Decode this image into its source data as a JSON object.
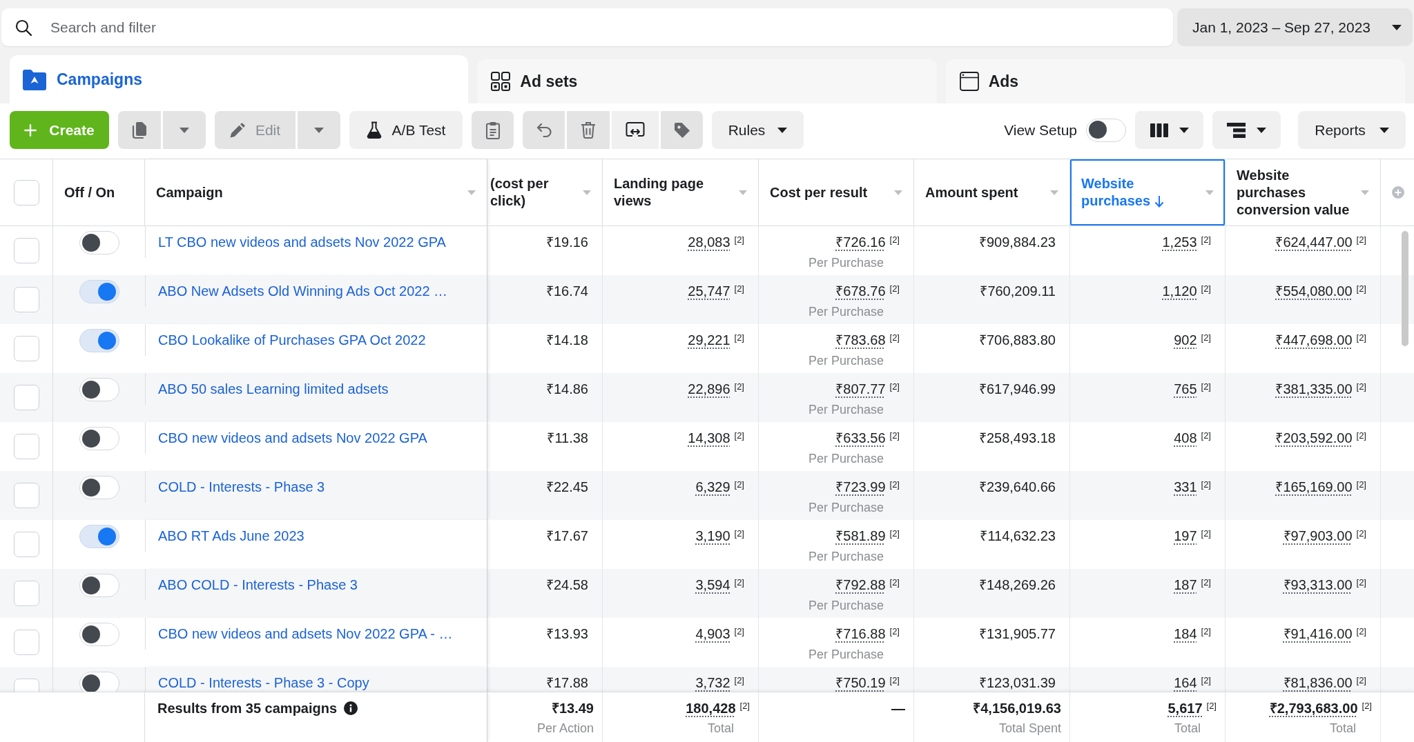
{
  "search": {
    "placeholder": "Search and filter"
  },
  "date_range": {
    "label": "Jan 1, 2023 – Sep 27, 2023"
  },
  "tabs": [
    {
      "label": "Campaigns",
      "selected": true
    },
    {
      "label": "Ad sets",
      "selected": false
    },
    {
      "label": "Ads",
      "selected": false
    }
  ],
  "toolbar": {
    "create": {
      "label": "Create"
    },
    "duplicate": {
      "disabled": true
    },
    "edit": {
      "label": "Edit",
      "disabled": true
    },
    "ab_test": {
      "label": "A/B Test",
      "disabled": false
    },
    "icon_buttons": [
      {
        "disabled": true
      },
      {
        "disabled": true
      },
      {
        "disabled": true
      },
      {
        "disabled": false
      },
      {
        "disabled": true
      }
    ],
    "rules": {
      "label": "Rules"
    },
    "view_setup": {
      "label": "View Setup",
      "on": false
    },
    "reports": {
      "label": "Reports"
    }
  },
  "table": {
    "select_all": {
      "checked": false
    },
    "toggle_header": {
      "label": "Off / On"
    },
    "name_header": {
      "label": "Campaign",
      "sorted": false
    },
    "columns": [
      {
        "label": "(cost per click)",
        "sorted": false
      },
      {
        "label": "Landing page views",
        "sorted": false
      },
      {
        "label": "Cost per result",
        "sorted": false
      },
      {
        "label": "Amount spent",
        "sorted": false
      },
      {
        "label": "Website purchases",
        "sorted": true
      },
      {
        "label": "Website purchases conversion value",
        "sorted": false
      }
    ],
    "rows": [
      {
        "selected": false,
        "on": false,
        "campaign": "LT CBO new videos and adsets Nov 2022 GPA",
        "cells": [
          {
            "value": "₹19.16"
          },
          {
            "value": "28,083",
            "note": "[2]"
          },
          {
            "value": "₹726.16",
            "note": "[2]",
            "caption": "Per Purchase"
          },
          {
            "value": "₹909,884.23"
          },
          {
            "value": "1,253",
            "note": "[2]"
          },
          {
            "value": "₹624,447.00",
            "note": "[2]"
          }
        ]
      },
      {
        "selected": false,
        "on": true,
        "campaign": "ABO New Adsets Old Winning Ads Oct 2022 …",
        "cells": [
          {
            "value": "₹16.74"
          },
          {
            "value": "25,747",
            "note": "[2]"
          },
          {
            "value": "₹678.76",
            "note": "[2]",
            "caption": "Per Purchase"
          },
          {
            "value": "₹760,209.11"
          },
          {
            "value": "1,120",
            "note": "[2]"
          },
          {
            "value": "₹554,080.00",
            "note": "[2]"
          }
        ]
      },
      {
        "selected": false,
        "on": true,
        "campaign": "CBO Lookalike of Purchases GPA Oct 2022",
        "cells": [
          {
            "value": "₹14.18"
          },
          {
            "value": "29,221",
            "note": "[2]"
          },
          {
            "value": "₹783.68",
            "note": "[2]",
            "caption": "Per Purchase"
          },
          {
            "value": "₹706,883.80"
          },
          {
            "value": "902",
            "note": "[2]"
          },
          {
            "value": "₹447,698.00",
            "note": "[2]"
          }
        ]
      },
      {
        "selected": false,
        "on": false,
        "campaign": "ABO 50 sales Learning limited adsets",
        "cells": [
          {
            "value": "₹14.86"
          },
          {
            "value": "22,896",
            "note": "[2]"
          },
          {
            "value": "₹807.77",
            "note": "[2]",
            "caption": "Per Purchase"
          },
          {
            "value": "₹617,946.99"
          },
          {
            "value": "765",
            "note": "[2]"
          },
          {
            "value": "₹381,335.00",
            "note": "[2]"
          }
        ]
      },
      {
        "selected": false,
        "on": false,
        "campaign": "CBO new videos and adsets Nov 2022 GPA",
        "cells": [
          {
            "value": "₹11.38"
          },
          {
            "value": "14,308",
            "note": "[2]"
          },
          {
            "value": "₹633.56",
            "note": "[2]",
            "caption": "Per Purchase"
          },
          {
            "value": "₹258,493.18"
          },
          {
            "value": "408",
            "note": "[2]"
          },
          {
            "value": "₹203,592.00",
            "note": "[2]"
          }
        ]
      },
      {
        "selected": false,
        "on": false,
        "campaign": "COLD - Interests - Phase 3",
        "cells": [
          {
            "value": "₹22.45"
          },
          {
            "value": "6,329",
            "note": "[2]"
          },
          {
            "value": "₹723.99",
            "note": "[2]",
            "caption": "Per Purchase"
          },
          {
            "value": "₹239,640.66"
          },
          {
            "value": "331",
            "note": "[2]"
          },
          {
            "value": "₹165,169.00",
            "note": "[2]"
          }
        ]
      },
      {
        "selected": false,
        "on": true,
        "campaign": "ABO RT Ads June 2023",
        "cells": [
          {
            "value": "₹17.67"
          },
          {
            "value": "3,190",
            "note": "[2]"
          },
          {
            "value": "₹581.89",
            "note": "[2]",
            "caption": "Per Purchase"
          },
          {
            "value": "₹114,632.23"
          },
          {
            "value": "197",
            "note": "[2]"
          },
          {
            "value": "₹97,903.00",
            "note": "[2]"
          }
        ]
      },
      {
        "selected": false,
        "on": false,
        "campaign": "ABO COLD - Interests - Phase 3",
        "cells": [
          {
            "value": "₹24.58"
          },
          {
            "value": "3,594",
            "note": "[2]"
          },
          {
            "value": "₹792.88",
            "note": "[2]",
            "caption": "Per Purchase"
          },
          {
            "value": "₹148,269.26"
          },
          {
            "value": "187",
            "note": "[2]"
          },
          {
            "value": "₹93,313.00",
            "note": "[2]"
          }
        ]
      },
      {
        "selected": false,
        "on": false,
        "campaign": "CBO new videos and adsets Nov 2022 GPA - …",
        "cells": [
          {
            "value": "₹13.93"
          },
          {
            "value": "4,903",
            "note": "[2]"
          },
          {
            "value": "₹716.88",
            "note": "[2]",
            "caption": "Per Purchase"
          },
          {
            "value": "₹131,905.77"
          },
          {
            "value": "184",
            "note": "[2]"
          },
          {
            "value": "₹91,416.00",
            "note": "[2]"
          }
        ]
      },
      {
        "selected": false,
        "on": false,
        "campaign": "COLD - Interests - Phase 3 - Copy",
        "cells": [
          {
            "value": "₹17.88"
          },
          {
            "value": "3,732",
            "note": "[2]"
          },
          {
            "value": "₹750.19",
            "note": "[2]"
          },
          {
            "value": "₹123,031.39"
          },
          {
            "value": "164",
            "note": "[2]"
          },
          {
            "value": "₹81,836.00",
            "note": "[2]"
          }
        ]
      }
    ],
    "summary": {
      "label": "Results from 35 campaigns",
      "cells": [
        {
          "value": "₹13.49",
          "caption": "Per Action"
        },
        {
          "value": "180,428",
          "note": "[2]",
          "caption": "Total"
        },
        {
          "value": "—"
        },
        {
          "value": "₹4,156,019.63",
          "caption": "Total Spent"
        },
        {
          "value": "5,617",
          "note": "[2]",
          "caption": "Total"
        },
        {
          "value": "₹2,793,683.00",
          "note": "[2]",
          "caption": "Total"
        }
      ]
    }
  }
}
